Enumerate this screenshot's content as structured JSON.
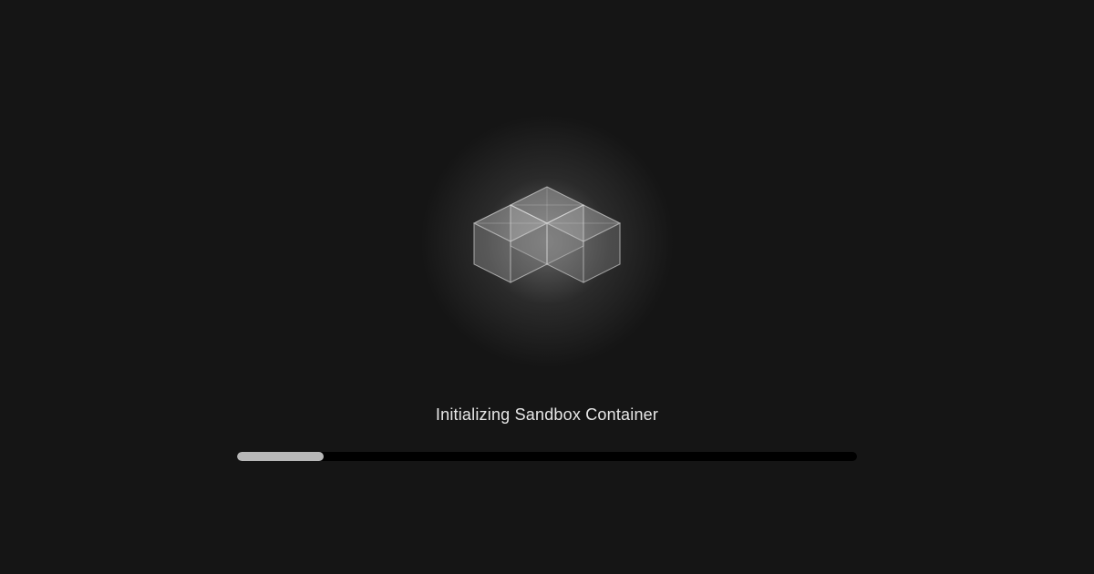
{
  "loading": {
    "status_text": "Initializing Sandbox Container",
    "progress_percent": 14
  }
}
